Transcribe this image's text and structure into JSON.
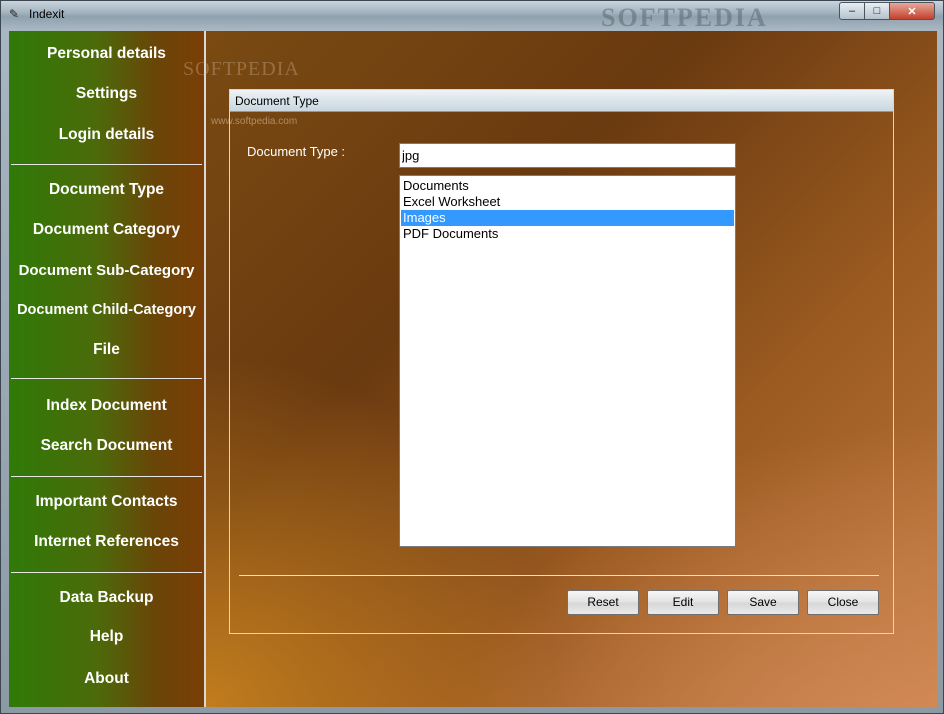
{
  "window": {
    "title": "Indexit",
    "watermark": "SOFTPEDIA",
    "controls": {
      "minimize": "–",
      "maximize": "□",
      "close": "✕"
    }
  },
  "sidebar": {
    "groups": [
      [
        "Personal details",
        "Settings",
        "Login details"
      ],
      [
        "Document Type",
        "Document Category",
        "Document Sub-Category",
        "Document Child-Category",
        "File"
      ],
      [
        "Index Document",
        "Search Document"
      ],
      [
        "Important Contacts",
        "Internet References"
      ],
      [
        "Data Backup",
        "Help",
        "About"
      ]
    ]
  },
  "background_watermark": {
    "text": "SOFTPEDIA",
    "url": "www.softpedia.com"
  },
  "dialog": {
    "title": "Document Type",
    "field_label": "Document Type :",
    "input_value": "jpg",
    "list_items": [
      "Documents",
      "Excel Worksheet",
      "Images",
      "PDF Documents"
    ],
    "selected_item": "Images",
    "buttons": {
      "reset": "Reset",
      "edit": "Edit",
      "save": "Save",
      "close": "Close"
    }
  },
  "colors": {
    "selection": "#3399ff",
    "sidebar_green": "#2f7a08",
    "sidebar_brown": "#7a3e06"
  }
}
